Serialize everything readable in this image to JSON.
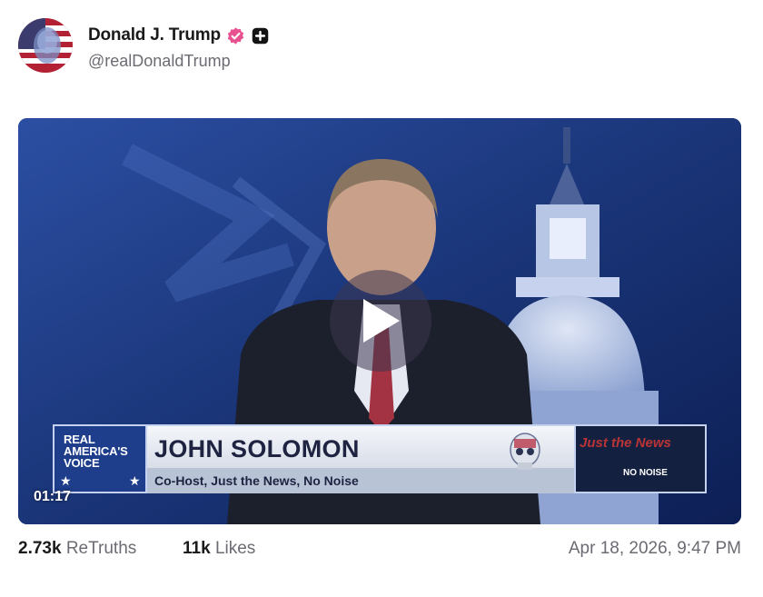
{
  "post": {
    "author": {
      "display_name": "Donald J. Trump",
      "handle": "@realDonaldTrump",
      "verified_icon": "verified-badge-icon",
      "plus_icon": "plus-badge-icon"
    },
    "video": {
      "duration": "01:17",
      "play_icon": "play-icon",
      "lower_third": {
        "network_lines": [
          "REAL",
          "AMERICA'S",
          "VOICE"
        ],
        "guest_name": "JOHN SOLOMON",
        "guest_title": "Co-Host, Just the News, No Noise",
        "show_logo_text": "Just the News",
        "show_tagline": "NO NOISE"
      }
    },
    "stats": {
      "retruths_count": "2.73k",
      "retruths_label": "ReTruths",
      "likes_count": "11k",
      "likes_label": "Likes"
    },
    "timestamp": "Apr 18, 2026, 9:47 PM"
  },
  "colors": {
    "verified_pink": "#e8508f",
    "text_muted": "#6b6b73",
    "video_bg": "#0b1a4a"
  }
}
